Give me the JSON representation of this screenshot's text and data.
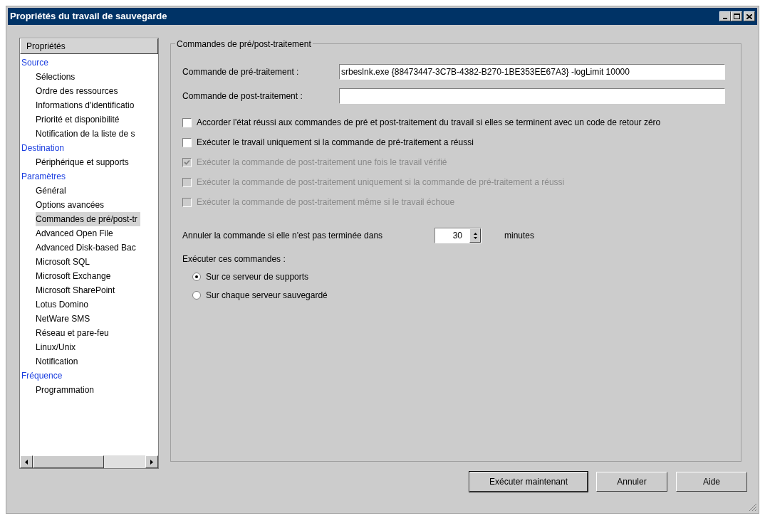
{
  "window": {
    "title": "Propriétés du travail de sauvegarde"
  },
  "tree": {
    "header": "Propriétés",
    "items": [
      {
        "label": "Source",
        "selected": false,
        "children": [
          {
            "label": "Sélections",
            "selected": false
          },
          {
            "label": "Ordre des ressources",
            "selected": false
          },
          {
            "label": "Informations d'identificatio",
            "selected": false
          },
          {
            "label": "Priorité et disponibilité",
            "selected": false
          },
          {
            "label": "Notification de la liste de s",
            "selected": false
          }
        ]
      },
      {
        "label": "Destination",
        "selected": false,
        "children": [
          {
            "label": "Périphérique et supports",
            "selected": false
          }
        ]
      },
      {
        "label": "Paramètres",
        "selected": false,
        "children": [
          {
            "label": "Général",
            "selected": false
          },
          {
            "label": "Options avancées",
            "selected": false
          },
          {
            "label": "Commandes de pré/post-tr",
            "selected": true
          },
          {
            "label": "Advanced Open File",
            "selected": false
          },
          {
            "label": "Advanced Disk-based Bac",
            "selected": false
          },
          {
            "label": "Microsoft SQL",
            "selected": false
          },
          {
            "label": "Microsoft Exchange",
            "selected": false
          },
          {
            "label": "Microsoft SharePoint",
            "selected": false
          },
          {
            "label": "Lotus Domino",
            "selected": false
          },
          {
            "label": "NetWare SMS",
            "selected": false
          },
          {
            "label": "Réseau et pare-feu",
            "selected": false
          },
          {
            "label": "Linux/Unix",
            "selected": false
          },
          {
            "label": "Notification",
            "selected": false
          }
        ]
      },
      {
        "label": "Fréquence",
        "selected": false,
        "children": [
          {
            "label": "Programmation",
            "selected": false
          }
        ]
      }
    ]
  },
  "group": {
    "title": "Commandes de pré/post-traitement",
    "fields": [
      {
        "label": "Commande de pré-traitement :",
        "value": "srbeslnk.exe {88473447-3C7B-4382-B270-1BE353EE67A3} -logLimit 10000"
      },
      {
        "label": "Commande de post-traitement :"
      }
    ],
    "checkboxes": [
      {
        "label": "Accorder l'état réussi aux commandes de pré et post-traitement du travail si elles se terminent avec un code de retour zéro",
        "checked": false,
        "disabled": false
      },
      {
        "label": "Exécuter le travail uniquement si la commande de pré-traitement a réussi",
        "checked": false,
        "disabled": false
      },
      {
        "label": "Exécuter la commande de post-traitement une fois le travail vérifié",
        "checked": true,
        "disabled": true
      },
      {
        "label": "Exécuter la commande de post-traitement uniquement si la commande de pré-traitement a réussi",
        "checked": false,
        "disabled": true
      },
      {
        "label": "Exécuter la commande de post-traitement même si le travail échoue",
        "checked": false,
        "disabled": true
      }
    ],
    "timeout": {
      "label": "Annuler la commande si elle n'est pas terminée dans",
      "value": "30",
      "unit": "minutes"
    },
    "run_on": {
      "label": "Exécuter ces commandes :",
      "options": [
        {
          "label": "Sur ce serveur de supports",
          "selected": true
        },
        {
          "label": "Sur chaque serveur sauvegardé",
          "selected": false
        }
      ]
    }
  },
  "buttons": [
    {
      "label": "Exécuter maintenant",
      "default": true
    },
    {
      "label": "Annuler",
      "default": false
    },
    {
      "label": "Aide",
      "default": false
    }
  ]
}
